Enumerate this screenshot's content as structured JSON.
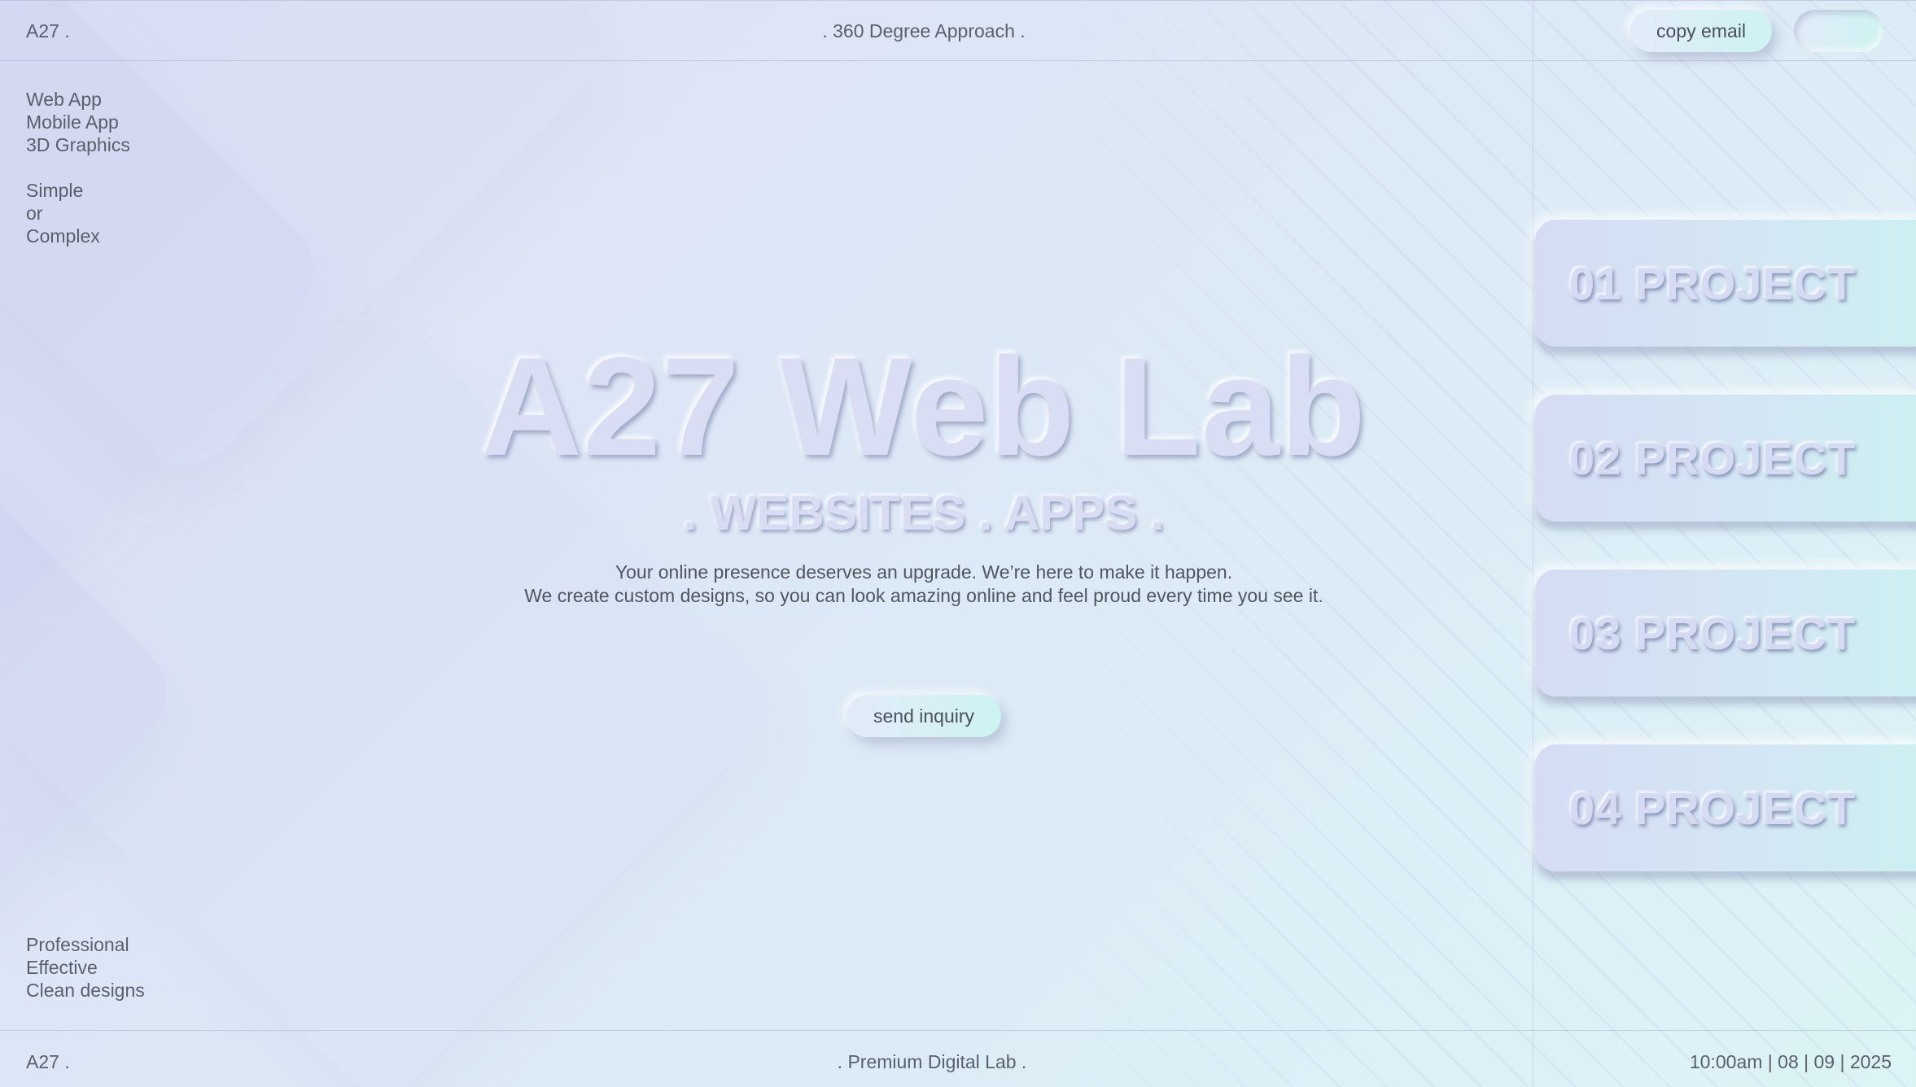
{
  "header": {
    "logo": "A27 .",
    "tagline": ". 360 Degree Approach .",
    "copy_email_label": "copy email",
    "toggle_label": ""
  },
  "services": [
    "Web App",
    "Mobile App",
    "3D Graphics"
  ],
  "scope": [
    "Simple",
    "or",
    "Complex"
  ],
  "hero": {
    "title": "A27 Web Lab",
    "subtitle": ". WEBSITES . APPS .",
    "line1": "Your online presence deserves an upgrade. We’re here to make it happen.",
    "line2": "We create custom designs, so you can look amazing online and feel proud every time you see it.",
    "cta_label": "send inquiry"
  },
  "projects": [
    {
      "label": "01 PROJECT"
    },
    {
      "label": "02 PROJECT"
    },
    {
      "label": "03 PROJECT"
    },
    {
      "label": "04 PROJECT"
    }
  ],
  "qualities": [
    "Professional",
    "Effective",
    "Clean designs"
  ],
  "footer": {
    "logo": "A27 .",
    "tagline": ". Premium Digital Lab .",
    "datetime": "10:00am | 08 | 09 | 2025"
  },
  "colors": {
    "background_start": "#dde0f6",
    "background_end": "#dcf4f6",
    "text": "#555a66",
    "pill_start": "#e3ebf9",
    "pill_end": "#cdf3f1"
  }
}
